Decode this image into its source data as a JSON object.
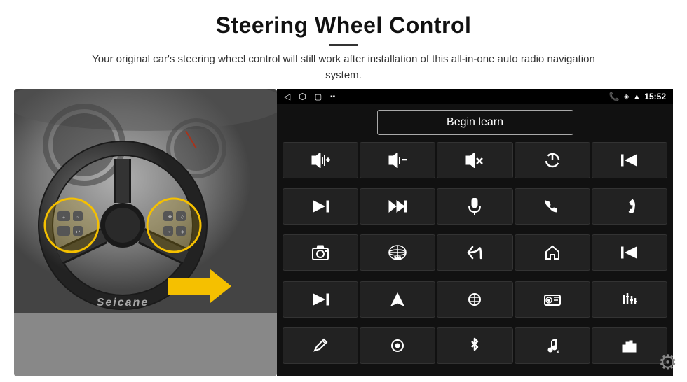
{
  "header": {
    "title": "Steering Wheel Control",
    "subtitle": "Your original car's steering wheel control will still work after installation of this all-in-one auto radio navigation system."
  },
  "status_bar": {
    "left_icons": [
      "◁",
      "⬜",
      "▢",
      "▪▪"
    ],
    "right_icons": [
      "📞",
      "◈",
      "WiFi",
      "15:52"
    ]
  },
  "begin_learn": {
    "label": "Begin learn"
  },
  "controls": [
    {
      "icon": "vol_up",
      "symbol": "🔊+"
    },
    {
      "icon": "vol_down",
      "symbol": "🔉−"
    },
    {
      "icon": "vol_mute",
      "symbol": "🔇×"
    },
    {
      "icon": "power",
      "symbol": "⏻"
    },
    {
      "icon": "prev_track",
      "symbol": "⏮"
    },
    {
      "icon": "next_track",
      "symbol": "⏭"
    },
    {
      "icon": "fast_forward",
      "symbol": "⏩"
    },
    {
      "icon": "mic",
      "symbol": "🎤"
    },
    {
      "icon": "phone",
      "symbol": "📞"
    },
    {
      "icon": "hang_up",
      "symbol": "📵"
    },
    {
      "icon": "camera",
      "symbol": "📷"
    },
    {
      "icon": "360_view",
      "symbol": "👁360"
    },
    {
      "icon": "back",
      "symbol": "↩"
    },
    {
      "icon": "home",
      "symbol": "⌂"
    },
    {
      "icon": "skip_back",
      "symbol": "⏮"
    },
    {
      "icon": "skip_forward",
      "symbol": "⏭"
    },
    {
      "icon": "navigate",
      "symbol": "➤"
    },
    {
      "icon": "swap",
      "symbol": "⇄"
    },
    {
      "icon": "radio",
      "symbol": "📻"
    },
    {
      "icon": "eq",
      "symbol": "🎚"
    },
    {
      "icon": "pen",
      "symbol": "✎"
    },
    {
      "icon": "settings_knob",
      "symbol": "⚙"
    },
    {
      "icon": "bluetooth",
      "symbol": "Ᵽ"
    },
    {
      "icon": "music",
      "symbol": "♫"
    },
    {
      "icon": "equalizer",
      "symbol": "📊"
    }
  ],
  "watermark": "Seicane",
  "colors": {
    "accent_yellow": "#f5c000",
    "panel_bg": "#111111",
    "btn_bg": "#222222",
    "btn_border": "#333333",
    "text_white": "#ffffff"
  }
}
